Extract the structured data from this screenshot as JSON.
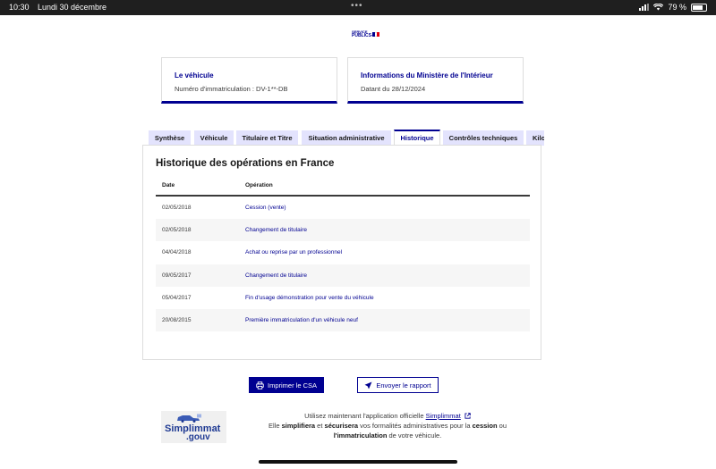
{
  "status_bar": {
    "time": "10:30",
    "date": "Lundi 30 décembre",
    "battery": "79 %"
  },
  "logo": {
    "line1": "SERVICE",
    "line2": "PUBLICS+",
    "flag_colors": [
      "#000091",
      "#ffffff",
      "#e1000f"
    ]
  },
  "cards": [
    {
      "title": "Le véhicule",
      "subtitle": "Numéro d'immatriculation : DV-1**-DB"
    },
    {
      "title": "Informations du Ministère de l'Intérieur",
      "subtitle": "Datant du 28/12/2024"
    }
  ],
  "tabs": [
    {
      "label": "Synthèse",
      "active": false
    },
    {
      "label": "Véhicule",
      "active": false
    },
    {
      "label": "Titulaire et Titre",
      "active": false
    },
    {
      "label": "Situation administrative",
      "active": false
    },
    {
      "label": "Historique",
      "active": true
    },
    {
      "label": "Contrôles techniques",
      "active": false
    },
    {
      "label": "Kilo",
      "active": false
    }
  ],
  "history": {
    "title": "Historique des opérations en France",
    "columns": [
      "Date",
      "Opération"
    ],
    "rows": [
      {
        "date": "02/05/2018",
        "operation": "Cession (vente)"
      },
      {
        "date": "02/05/2018",
        "operation": "Changement de titulaire"
      },
      {
        "date": "04/04/2018",
        "operation": "Achat ou reprise par un professionnel"
      },
      {
        "date": "09/05/2017",
        "operation": "Changement de titulaire"
      },
      {
        "date": "05/04/2017",
        "operation": "Fin d'usage démonstration pour vente du véhicule"
      },
      {
        "date": "20/08/2015",
        "operation": "Première immatriculation d'un véhicule neuf"
      }
    ]
  },
  "actions": {
    "print_label": "Imprimer le CSA",
    "send_label": "Envoyer le rapport"
  },
  "promo": {
    "logo_text_1": "Simplimmat",
    "logo_text_2": ".gouv",
    "line1_prefix": "Utilisez maintenant l'application officielle ",
    "link": "Simplimmat",
    "line2_prefix": "Elle ",
    "bold1": "simplifiera",
    "mid1": " et ",
    "bold2": "sécurisera",
    "mid2": " vos formalités administratives pour la ",
    "bold3": "cession",
    "mid3": " ou",
    "bold4": "l'immatriculation",
    "end": " de votre véhicule."
  },
  "colors": {
    "primary": "#000091",
    "tab_bg": "#e3e3fd",
    "row_alt": "#f6f6f6"
  }
}
